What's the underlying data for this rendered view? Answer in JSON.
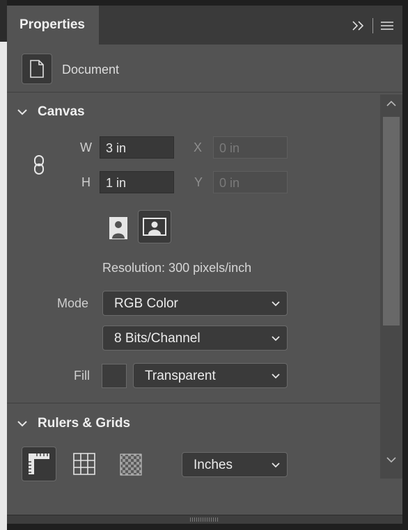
{
  "panel": {
    "tab_title": "Properties",
    "icons": {
      "collapse": "double-chevron-right-icon",
      "menu": "hamburger-menu-icon"
    }
  },
  "document": {
    "icon": "document-icon",
    "label": "Document"
  },
  "canvas": {
    "section_title": "Canvas",
    "width_label": "W",
    "width_value": "3 in",
    "height_label": "H",
    "height_value": "1 in",
    "x_label": "X",
    "x_placeholder": "0 in",
    "y_label": "Y",
    "y_placeholder": "0 in",
    "link_icon": "chain-link-icon",
    "orientation": {
      "portrait_icon": "portrait-icon",
      "landscape_icon": "landscape-icon",
      "selected": "landscape"
    },
    "resolution_text": "Resolution: 300 pixels/inch",
    "mode_label": "Mode",
    "mode_value": "RGB Color",
    "bit_depth_value": "8 Bits/Channel",
    "fill_label": "Fill",
    "fill_value": "Transparent"
  },
  "rulers_grids": {
    "section_title": "Rulers & Grids",
    "icons": [
      "ruler-icon",
      "grid-icon",
      "transparency-grid-icon"
    ],
    "units_value": "Inches"
  },
  "colors": {
    "panel_bg": "#535353",
    "field_bg": "#383838",
    "tab_bar": "#3a3a3a"
  }
}
